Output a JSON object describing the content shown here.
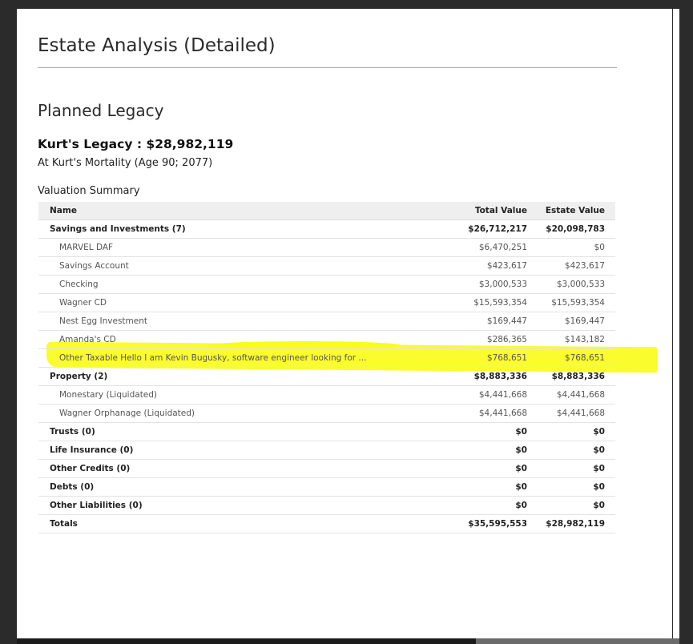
{
  "doc": {
    "title": "Estate Analysis (Detailed)",
    "section": "Planned Legacy",
    "legacy_heading": "Kurt's Legacy : $28,982,119",
    "legacy_sub": "At Kurt's Mortality (Age 90; 2077)",
    "table_caption": "Valuation Summary"
  },
  "table": {
    "columns": [
      "Name",
      "Total Value",
      "Estate Value"
    ],
    "rows": [
      {
        "name": "Savings and Investments (7)",
        "total": "$26,712,217",
        "estate": "$20,098,783",
        "kind": "group"
      },
      {
        "name": "MARVEL DAF",
        "total": "$6,470,251",
        "estate": "$0",
        "kind": "detail"
      },
      {
        "name": "Savings Account",
        "total": "$423,617",
        "estate": "$423,617",
        "kind": "detail"
      },
      {
        "name": "Checking",
        "total": "$3,000,533",
        "estate": "$3,000,533",
        "kind": "detail"
      },
      {
        "name": "Wagner CD",
        "total": "$15,593,354",
        "estate": "$15,593,354",
        "kind": "detail"
      },
      {
        "name": "Nest Egg Investment",
        "total": "$169,447",
        "estate": "$169,447",
        "kind": "detail"
      },
      {
        "name": "Amanda's CD",
        "total": "$286,365",
        "estate": "$143,182",
        "kind": "detail"
      },
      {
        "name": "Other Taxable Hello I am Kevin Bugusky, software engineer looking for ...",
        "total": "$768,651",
        "estate": "$768,651",
        "kind": "detail"
      },
      {
        "name": "Property (2)",
        "total": "$8,883,336",
        "estate": "$8,883,336",
        "kind": "group"
      },
      {
        "name": "Monestary (Liquidated)",
        "total": "$4,441,668",
        "estate": "$4,441,668",
        "kind": "detail"
      },
      {
        "name": "Wagner Orphanage (Liquidated)",
        "total": "$4,441,668",
        "estate": "$4,441,668",
        "kind": "detail"
      },
      {
        "name": "Trusts (0)",
        "total": "$0",
        "estate": "$0",
        "kind": "group"
      },
      {
        "name": "Life Insurance (0)",
        "total": "$0",
        "estate": "$0",
        "kind": "group"
      },
      {
        "name": "Other Credits (0)",
        "total": "$0",
        "estate": "$0",
        "kind": "group"
      },
      {
        "name": "Debts (0)",
        "total": "$0",
        "estate": "$0",
        "kind": "group"
      },
      {
        "name": "Other Liabilities (0)",
        "total": "$0",
        "estate": "$0",
        "kind": "group"
      },
      {
        "name": "Totals",
        "total": "$35,595,553",
        "estate": "$28,982,119",
        "kind": "group"
      }
    ]
  },
  "colors": {
    "highlight": "#fafc1c",
    "header_bg": "#efefef"
  }
}
